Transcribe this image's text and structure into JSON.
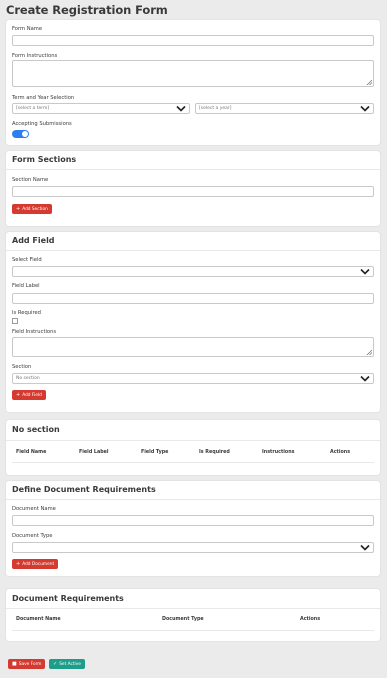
{
  "page": {
    "title": "Create Registration Form"
  },
  "form": {
    "name_label": "Form Name",
    "instructions_label": "Form Instructions",
    "term_year_label": "Term and Year Selection",
    "term_placeholder": "[select a term]",
    "year_placeholder": "[select a year]",
    "accepting_label": "Accepting Submissions",
    "accepting_on": true
  },
  "sections": {
    "title": "Form Sections",
    "section_name_label": "Section Name",
    "add_button": "Add Section"
  },
  "add_field": {
    "title": "Add Field",
    "select_field_label": "Select Field",
    "field_label_label": "Field Label",
    "is_required_label": "Is Required",
    "field_instructions_label": "Field Instructions",
    "section_label": "Section",
    "section_value": "No section",
    "add_button": "Add Field"
  },
  "no_section": {
    "title": "No section",
    "columns": [
      "Field Name",
      "Field Label",
      "Field Type",
      "Is Required",
      "Instructions",
      "Actions"
    ]
  },
  "documents": {
    "title": "Define Document Requirements",
    "name_label": "Document Name",
    "type_label": "Document Type",
    "add_button": "Add Document"
  },
  "requirements": {
    "title": "Document Requirements",
    "columns": [
      "Document Name",
      "Document Type",
      "Actions"
    ]
  },
  "footer": {
    "save_button": "Save Form",
    "active_button": "Set Active"
  },
  "colors": {
    "primary": "#2d7ff0",
    "danger": "#d53a30",
    "success": "#1f9d8a"
  }
}
